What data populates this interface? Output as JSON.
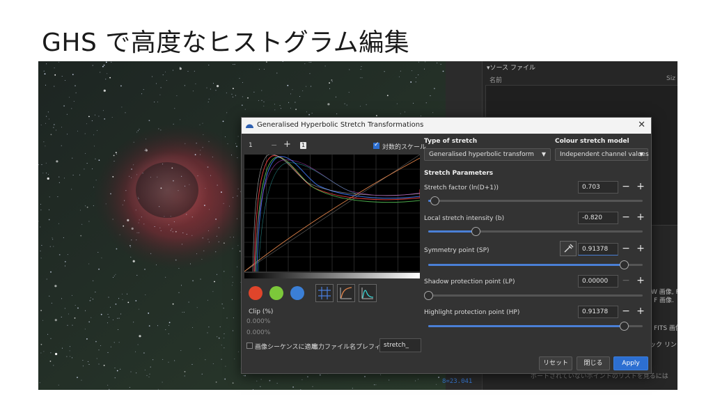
{
  "slide_title": "GHS で高度なヒストグラム編集",
  "background_panel": {
    "source_header": "ソース ファイル",
    "col_name": "名前",
    "col_size": "Siz",
    "text_fragments": [
      "W 画像, F",
      "F 画像.",
      "FITS 画像",
      "ック リンク",
      "ポートされていないポイントのリストを見るには 'help' をタイプしてください"
    ],
    "status_text": "8=23.041"
  },
  "dialog": {
    "title": "Generalised Hyperbolic Stretch Transformations",
    "close_glyph": "✕",
    "zoom_value": "1",
    "zoom_minus": "−",
    "zoom_plus": "+",
    "badge": "1",
    "log_scale_label": "対数的スケール",
    "log_scale_checked": true,
    "type_of_stretch_label": "Type of stretch",
    "type_of_stretch_value": "Generalised hyperbolic transform",
    "colour_model_label": "Colour stretch model",
    "colour_model_value": "Independent channel values",
    "stretch_params_label": "Stretch Parameters",
    "params": [
      {
        "label": "Stretch factor (ln(D+1))",
        "value": "0.703",
        "fraction": 0.03
      },
      {
        "label": "Local stretch intensity (b)",
        "value": "-0.820",
        "fraction": 0.22
      },
      {
        "label": "Symmetry point (SP)",
        "value": "0.91378",
        "fraction": 0.91378
      },
      {
        "label": "Shadow protection point (LP)",
        "value": "0.00000",
        "fraction": 0.0
      },
      {
        "label": "Highlight protection point (HP)",
        "value": "0.91378",
        "fraction": 0.91378
      }
    ],
    "clip_label": "Clip (%)",
    "clip_low": "0.000%",
    "clip_high": "0.000%",
    "sequence_label": "画像シーケンスに適用",
    "prefix_label": "出力ファイル名プレフィックス:",
    "prefix_value": "stretch_",
    "reset_label": "リセット",
    "close_label": "閉じる",
    "apply_label": "Apply",
    "channel_colors": {
      "red": "#e0452b",
      "green": "#7cc83a",
      "blue": "#3b7fd6"
    }
  }
}
